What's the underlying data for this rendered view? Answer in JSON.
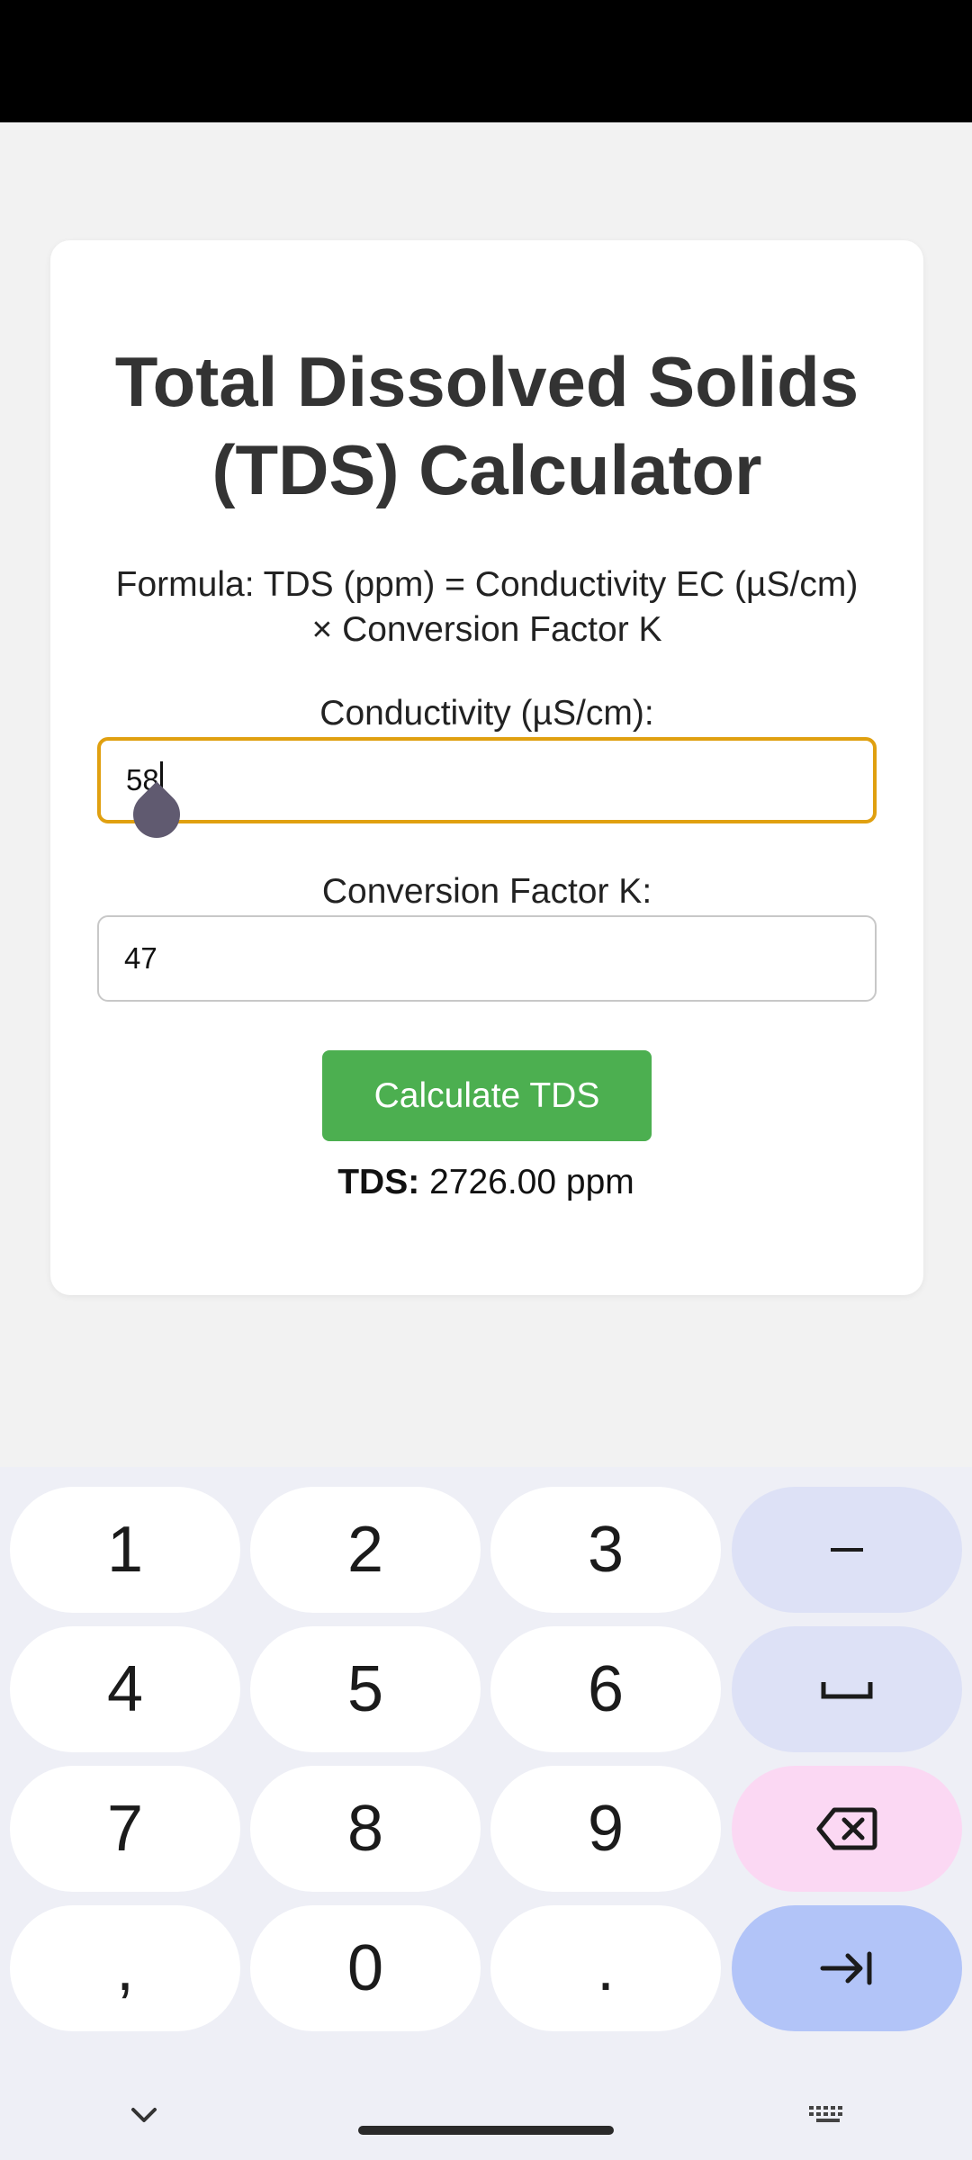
{
  "title": "Total Dissolved Solids (TDS) Calculator",
  "formula": "Formula: TDS (ppm) = Conductivity EC (µS/cm) × Conversion Factor K",
  "conductivity": {
    "label": "Conductivity (µS/cm):",
    "value": "58"
  },
  "factor": {
    "label": "Conversion Factor K:",
    "value": "47"
  },
  "calculate_button": "Calculate TDS",
  "result": {
    "label": "TDS:",
    "value": "2726.00 ppm"
  },
  "keyboard": {
    "keys": [
      "1",
      "2",
      "3",
      "4",
      "5",
      "6",
      "7",
      "8",
      "9",
      ",",
      "0",
      "."
    ],
    "function_keys": [
      "minus-icon",
      "space-icon",
      "backspace-icon",
      "tab-next-icon"
    ],
    "bottom_icons": [
      "chevron-down-icon",
      "keyboard-icon"
    ]
  },
  "colors": {
    "accent_focus": "#e0a010",
    "button": "#4caf50",
    "key_fn": "#dde1f6",
    "key_delete": "#fbd8f3",
    "key_go": "#b2c4f8"
  }
}
